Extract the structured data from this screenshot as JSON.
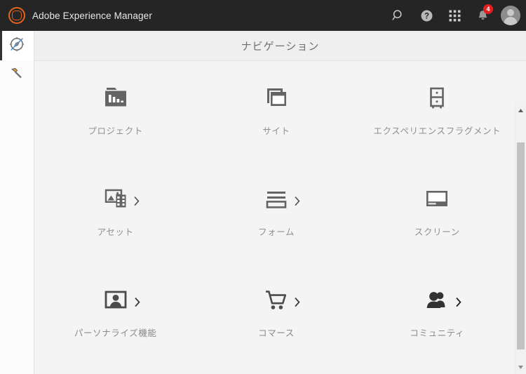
{
  "topbar": {
    "logo_icon": "adobe-experience-manager-logo-icon",
    "brand_title": "Adobe Experience Manager",
    "actions": [
      {
        "name": "search-icon",
        "label": "Search"
      },
      {
        "name": "help-icon",
        "label": "Help"
      },
      {
        "name": "solutions-grid-icon",
        "label": "Solutions"
      },
      {
        "name": "notifications-bell-icon",
        "label": "Notifications",
        "badge": "4"
      },
      {
        "name": "user-avatar",
        "label": "User"
      }
    ],
    "notification_count": "4",
    "badge_color": "#e02020",
    "background_color": "#252525",
    "logo_color": "#e3651f"
  },
  "rail": {
    "items": [
      {
        "name": "navigation",
        "icon": "compass-icon",
        "label": "ナビゲーション",
        "selected": true
      },
      {
        "name": "tools",
        "icon": "hammer-icon",
        "label": "ツール",
        "selected": false
      }
    ]
  },
  "titlebar": {
    "title": "ナビゲーション"
  },
  "navigation": {
    "tiles": [
      {
        "label": "プロジェクト",
        "icon": "projects-folder-chart-icon",
        "chevron": false
      },
      {
        "label": "サイト",
        "icon": "sites-windows-icon",
        "chevron": false
      },
      {
        "label": "エクスペリエンスフラグメント",
        "icon": "experience-fragments-cabinet-icon",
        "chevron": false
      },
      {
        "label": "アセット",
        "icon": "assets-image-film-icon",
        "chevron": true
      },
      {
        "label": "フォーム",
        "icon": "forms-lines-icon",
        "chevron": true
      },
      {
        "label": "スクリーン",
        "icon": "screens-monitor-icon",
        "chevron": false
      },
      {
        "label": "パーソナライズ機能",
        "icon": "personalization-portrait-icon",
        "chevron": true
      },
      {
        "label": "コマース",
        "icon": "commerce-cart-icon",
        "chevron": true
      },
      {
        "label": "コミュニティ",
        "icon": "communities-people-icon",
        "chevron": true
      }
    ]
  },
  "scrollbar": {
    "up_arrow": "scroll-up-arrow-icon",
    "down_arrow": "scroll-down-arrow-icon",
    "thumb_color": "#c2c2c2"
  }
}
